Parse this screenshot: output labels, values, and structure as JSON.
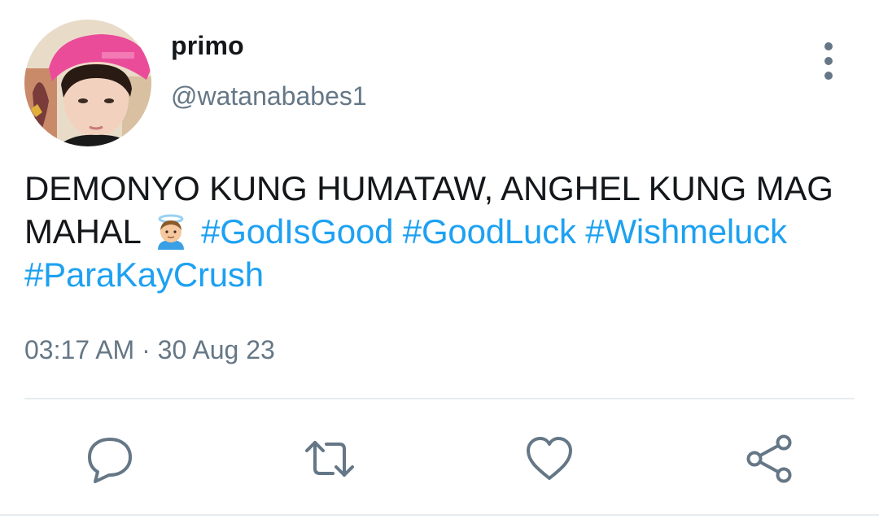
{
  "user": {
    "display_name": "primo",
    "handle": "@watanababes1",
    "avatar_icon": "profile-photo"
  },
  "tweet": {
    "text_line": "DEMONYO KUNG HUMATAW, ANGHEL KUNG MAG MAHAL",
    "emoji": "angel-emoji",
    "hashtags": [
      "#GodIsGood",
      "#GoodLuck",
      "#Wishmeluck",
      "#ParaKayCrush"
    ],
    "timestamp": "03:17 AM · 30 Aug 23"
  },
  "actions": {
    "more_icon": "more-vertical-icon",
    "reply_icon": "reply-icon",
    "retweet_icon": "retweet-icon",
    "like_icon": "heart-icon",
    "share_icon": "share-icon"
  },
  "colors": {
    "text": "#14171a",
    "secondary": "#657786",
    "hashtag": "#1da1f2",
    "divider": "#e6ecf0"
  }
}
